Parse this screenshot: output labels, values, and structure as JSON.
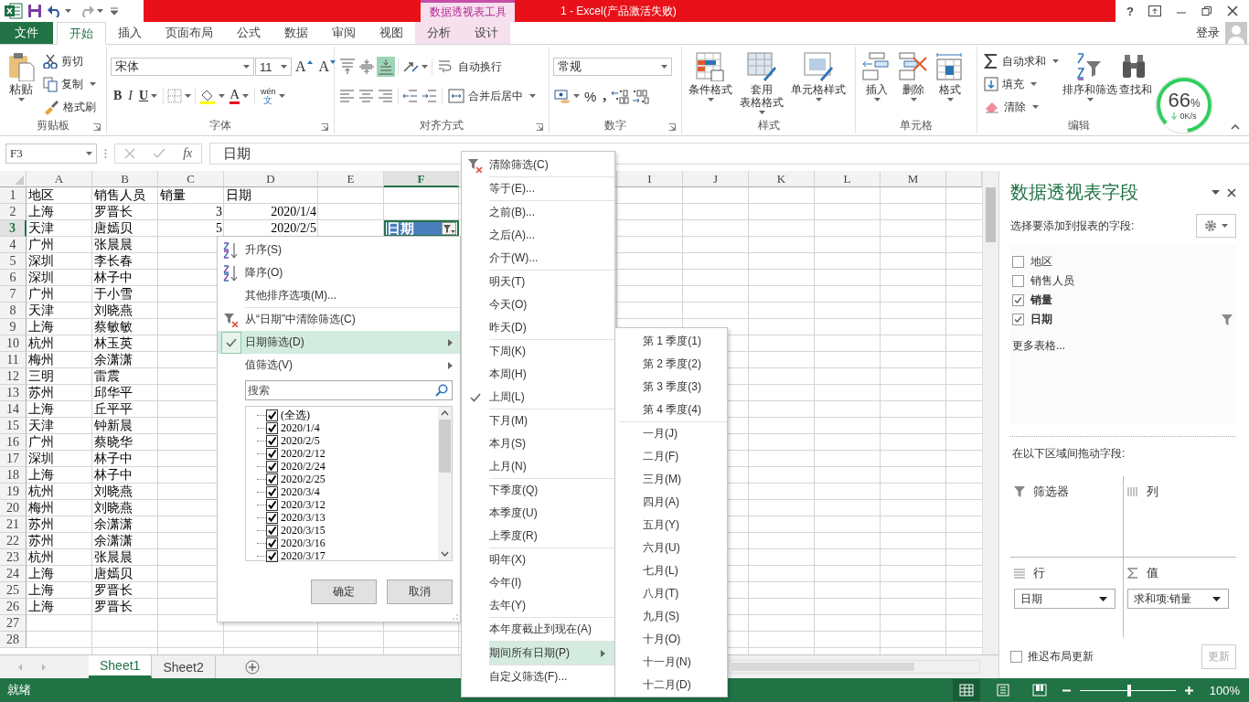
{
  "title_bar": {
    "context_tools": "数据透视表工具",
    "title": "1 -  Excel(产品激活失败)",
    "help": "?"
  },
  "ribbon_tabs": [
    {
      "label": "文件",
      "kind": "file",
      "selected": false
    },
    {
      "label": "开始",
      "kind": "tab",
      "selected": true
    },
    {
      "label": "插入",
      "kind": "tab",
      "selected": false
    },
    {
      "label": "页面布局",
      "kind": "tab",
      "selected": false
    },
    {
      "label": "公式",
      "kind": "tab",
      "selected": false
    },
    {
      "label": "数据",
      "kind": "tab",
      "selected": false
    },
    {
      "label": "审阅",
      "kind": "tab",
      "selected": false
    },
    {
      "label": "视图",
      "kind": "tab",
      "selected": false
    },
    {
      "label": "分析",
      "kind": "context",
      "selected": false
    },
    {
      "label": "设计",
      "kind": "context",
      "selected": false
    }
  ],
  "account": {
    "sign_in": "登录"
  },
  "ribbon_groups": [
    {
      "kind": "clipboard",
      "label": "剪贴板",
      "launcher": true,
      "paste": "粘贴",
      "cut": "剪切",
      "copy": "复制",
      "format_painter": "格式刷"
    },
    {
      "kind": "font",
      "label": "字体",
      "launcher": true,
      "font_name": "宋体",
      "font_size": "11",
      "grow": "A",
      "shrink": "A",
      "bold": "B",
      "italic": "I",
      "underline": "U",
      "font_color": "A",
      "phonetic_top": "wén",
      "phonetic_bottom": "文"
    },
    {
      "kind": "alignment",
      "label": "对齐方式",
      "launcher": true,
      "vertical_align": [
        {
          "selected": false
        },
        {
          "selected": false
        },
        {
          "selected": true
        }
      ],
      "wrap_text": "自动换行",
      "merge": "合并后居中"
    },
    {
      "kind": "number",
      "label": "数字",
      "launcher": true,
      "format": "常规",
      "percent": "%",
      "comma": ","
    },
    {
      "kind": "styles",
      "label": "样式",
      "launcher": false,
      "items": [
        {
          "lines": [
            "条件格式"
          ]
        },
        {
          "lines": [
            "套用",
            "表格格式"
          ]
        },
        {
          "lines": [
            "单元格样式"
          ]
        }
      ]
    },
    {
      "kind": "cells",
      "label": "单元格",
      "launcher": false,
      "items": [
        {
          "lines": [
            "插入"
          ]
        },
        {
          "lines": [
            "删除"
          ]
        },
        {
          "lines": [
            "格式"
          ]
        }
      ]
    },
    {
      "kind": "editing",
      "label": "编辑",
      "launcher": false,
      "autosum": "自动求和",
      "fill": "填充",
      "clear": "清除",
      "sort_filter": "排序和筛选",
      "find": "查找和"
    }
  ],
  "speed_widget": {
    "percent": "66",
    "unit": "%",
    "rate": "0K/s"
  },
  "formula_bar": {
    "name_box": "F3",
    "function_label": "fx",
    "value": "日期"
  },
  "sheet": {
    "columns": [
      {
        "label": "A",
        "selected": false
      },
      {
        "label": "B",
        "selected": false
      },
      {
        "label": "C",
        "selected": false
      },
      {
        "label": "D",
        "selected": false
      },
      {
        "label": "E",
        "selected": false
      },
      {
        "label": "F",
        "selected": true
      },
      {
        "label": "I",
        "selected": false,
        "after_hidden": true
      },
      {
        "label": "J",
        "selected": false
      },
      {
        "label": "K",
        "selected": false
      },
      {
        "label": "L",
        "selected": false
      },
      {
        "label": "M",
        "selected": false
      }
    ],
    "rows": [
      {
        "header": "1",
        "selected": false,
        "cells": [
          "地区",
          "销售人员",
          "销量",
          "日期"
        ]
      },
      {
        "header": "2",
        "selected": false,
        "numbers": true,
        "cells": [
          "上海",
          "罗晋长",
          "3",
          "2020/1/4"
        ]
      },
      {
        "header": "3",
        "selected": true,
        "numbers": true,
        "cells": [
          "天津",
          "唐嫣贝",
          "5",
          "2020/2/5",
          null,
          {
            "text": "日期",
            "kind": "pivot-header",
            "selected": true
          }
        ]
      },
      {
        "header": "4",
        "selected": false,
        "cells": [
          "广州",
          "张晨晨"
        ]
      },
      {
        "header": "5",
        "selected": false,
        "cells": [
          "深圳",
          "李长春"
        ]
      },
      {
        "header": "6",
        "selected": false,
        "cells": [
          "深圳",
          "林子中"
        ]
      },
      {
        "header": "7",
        "selected": false,
        "cells": [
          "广州",
          "于小雪"
        ]
      },
      {
        "header": "8",
        "selected": false,
        "cells": [
          "天津",
          "刘晓燕"
        ]
      },
      {
        "header": "9",
        "selected": false,
        "cells": [
          "上海",
          "蔡敏敏"
        ]
      },
      {
        "header": "10",
        "selected": false,
        "cells": [
          "杭州",
          "林玉英"
        ]
      },
      {
        "header": "11",
        "selected": false,
        "cells": [
          "梅州",
          "余潇潇"
        ]
      },
      {
        "header": "12",
        "selected": false,
        "cells": [
          "三明",
          "雷震"
        ]
      },
      {
        "header": "13",
        "selected": false,
        "cells": [
          "苏州",
          "邱华平"
        ]
      },
      {
        "header": "14",
        "selected": false,
        "cells": [
          "上海",
          "丘平平"
        ]
      },
      {
        "header": "15",
        "selected": false,
        "cells": [
          "天津",
          "钟新晨"
        ]
      },
      {
        "header": "16",
        "selected": false,
        "cells": [
          "广州",
          "蔡晓华"
        ]
      },
      {
        "header": "17",
        "selected": false,
        "cells": [
          "深圳",
          "林子中"
        ]
      },
      {
        "header": "18",
        "selected": false,
        "cells": [
          "上海",
          "林子中"
        ]
      },
      {
        "header": "19",
        "selected": false,
        "cells": [
          "杭州",
          "刘晓燕"
        ]
      },
      {
        "header": "20",
        "selected": false,
        "cells": [
          "梅州",
          "刘晓燕"
        ]
      },
      {
        "header": "21",
        "selected": false,
        "cells": [
          "苏州",
          "余潇潇"
        ]
      },
      {
        "header": "22",
        "selected": false,
        "cells": [
          "苏州",
          "余潇潇"
        ]
      },
      {
        "header": "23",
        "selected": false,
        "cells": [
          "杭州",
          "张晨晨"
        ]
      },
      {
        "header": "24",
        "selected": false,
        "cells": [
          "上海",
          "唐嫣贝"
        ]
      },
      {
        "header": "25",
        "selected": false,
        "cells": [
          "上海",
          "罗晋长"
        ]
      },
      {
        "header": "26",
        "selected": false,
        "cells": [
          "上海",
          "罗晋长"
        ]
      },
      {
        "header": "27",
        "selected": false,
        "cells": []
      },
      {
        "header": "28",
        "selected": false,
        "cells": []
      }
    ]
  },
  "sheet_tabs": [
    {
      "label": "Sheet1",
      "selected": true
    },
    {
      "label": "Sheet2",
      "selected": false
    }
  ],
  "filter_menu": {
    "items": [
      {
        "label": "升序(S)",
        "kind": "sort-asc",
        "checked": false,
        "selected": false
      },
      {
        "label": "降序(O)",
        "kind": "sort-desc",
        "checked": false,
        "selected": false
      },
      {
        "label": "其他排序选项(M)...",
        "kind": "item",
        "checked": false,
        "selected": false
      },
      {
        "label": "从“日期”中清除筛选(C)",
        "kind": "clear-filter",
        "checked": false,
        "selected": false,
        "divider_before": true
      },
      {
        "label": "日期筛选(D)",
        "kind": "submenu",
        "checked": true,
        "selected": true
      },
      {
        "label": "值筛选(V)",
        "kind": "submenu",
        "checked": false,
        "selected": false
      }
    ],
    "search_placeholder": "搜索",
    "values": [
      {
        "label": "(全选)",
        "checked": true
      },
      {
        "label": "2020/1/4",
        "checked": true
      },
      {
        "label": "2020/2/5",
        "checked": true
      },
      {
        "label": "2020/2/12",
        "checked": true
      },
      {
        "label": "2020/2/24",
        "checked": true
      },
      {
        "label": "2020/2/25",
        "checked": true
      },
      {
        "label": "2020/3/4",
        "checked": true
      },
      {
        "label": "2020/3/12",
        "checked": true
      },
      {
        "label": "2020/3/13",
        "checked": true
      },
      {
        "label": "2020/3/15",
        "checked": true
      },
      {
        "label": "2020/3/16",
        "checked": true
      },
      {
        "label": "2020/3/17",
        "checked": true
      }
    ],
    "ok": "确定",
    "cancel": "取消"
  },
  "date_filter_menu": {
    "items": [
      {
        "label": "清除筛选(C)",
        "kind": "clear-filter",
        "checked": false,
        "selected": false
      },
      {
        "label": "等于(E)...",
        "kind": "item",
        "checked": false,
        "selected": false,
        "divider_before": true
      },
      {
        "label": "之前(B)...",
        "kind": "item",
        "checked": false,
        "selected": false,
        "divider_before": true
      },
      {
        "label": "之后(A)...",
        "kind": "item",
        "checked": false,
        "selected": false
      },
      {
        "label": "介于(W)...",
        "kind": "item",
        "checked": false,
        "selected": false
      },
      {
        "label": "明天(T)",
        "kind": "item",
        "checked": false,
        "selected": false,
        "divider_before": true
      },
      {
        "label": "今天(O)",
        "kind": "item",
        "checked": false,
        "selected": false
      },
      {
        "label": "昨天(D)",
        "kind": "item",
        "checked": false,
        "selected": false
      },
      {
        "label": "下周(K)",
        "kind": "item",
        "checked": false,
        "selected": false,
        "divider_before": true
      },
      {
        "label": "本周(H)",
        "kind": "item",
        "checked": false,
        "selected": false
      },
      {
        "label": "上周(L)",
        "kind": "item",
        "checked": true,
        "selected": false
      },
      {
        "label": "下月(M)",
        "kind": "item",
        "checked": false,
        "selected": false,
        "divider_before": true
      },
      {
        "label": "本月(S)",
        "kind": "item",
        "checked": false,
        "selected": false
      },
      {
        "label": "上月(N)",
        "kind": "item",
        "checked": false,
        "selected": false
      },
      {
        "label": "下季度(Q)",
        "kind": "item",
        "checked": false,
        "selected": false,
        "divider_before": true
      },
      {
        "label": "本季度(U)",
        "kind": "item",
        "checked": false,
        "selected": false
      },
      {
        "label": "上季度(R)",
        "kind": "item",
        "checked": false,
        "selected": false
      },
      {
        "label": "明年(X)",
        "kind": "item",
        "checked": false,
        "selected": false,
        "divider_before": true
      },
      {
        "label": "今年(I)",
        "kind": "item",
        "checked": false,
        "selected": false
      },
      {
        "label": "去年(Y)",
        "kind": "item",
        "checked": false,
        "selected": false
      },
      {
        "label": "本年度截止到现在(A)",
        "kind": "item",
        "checked": false,
        "selected": false,
        "divider_before": true
      },
      {
        "label": "期间所有日期(P)",
        "kind": "submenu",
        "checked": false,
        "selected": true,
        "divider_before": true
      },
      {
        "label": "自定义筛选(F)...",
        "kind": "item",
        "checked": false,
        "selected": false,
        "divider_before": true
      }
    ]
  },
  "period_menu": {
    "items": [
      {
        "label": "第 1 季度(1)"
      },
      {
        "label": "第 2 季度(2)"
      },
      {
        "label": "第 3 季度(3)"
      },
      {
        "label": "第 4 季度(4)"
      },
      {
        "label": "一月(J)",
        "divider_before": true
      },
      {
        "label": "二月(F)"
      },
      {
        "label": "三月(M)"
      },
      {
        "label": "四月(A)"
      },
      {
        "label": "五月(Y)"
      },
      {
        "label": "六月(U)"
      },
      {
        "label": "七月(L)"
      },
      {
        "label": "八月(T)"
      },
      {
        "label": "九月(S)"
      },
      {
        "label": "十月(O)"
      },
      {
        "label": "十一月(N)"
      },
      {
        "label": "十二月(D)"
      }
    ]
  },
  "pivot_pane": {
    "title": "数据透视表字段",
    "prompt": "选择要添加到报表的字段:",
    "fields": [
      {
        "label": "地区",
        "checked": false,
        "filtered": false
      },
      {
        "label": "销售人员",
        "checked": false,
        "filtered": false
      },
      {
        "label": "销量",
        "checked": true,
        "filtered": false
      },
      {
        "label": "日期",
        "checked": true,
        "filtered": true
      }
    ],
    "more_tables": "更多表格...",
    "areas_prompt": "在以下区域间拖动字段:",
    "areas": [
      {
        "kind": "filters",
        "label": "筛选器"
      },
      {
        "kind": "columns",
        "label": "列"
      },
      {
        "kind": "rows",
        "label": "行",
        "chips": [
          "日期"
        ]
      },
      {
        "kind": "values",
        "label": "值",
        "chips": [
          "求和项:销量"
        ]
      }
    ],
    "defer_update": {
      "label": "推迟布局更新",
      "checked": false
    },
    "update_button": {
      "label": "更新",
      "disabled": true
    }
  },
  "status_bar": {
    "status": "就绪",
    "views": [
      {
        "selected": true
      },
      {
        "selected": false
      },
      {
        "selected": false
      }
    ],
    "zoom": {
      "level": 0.5
    },
    "zoom_label": "100%"
  }
}
